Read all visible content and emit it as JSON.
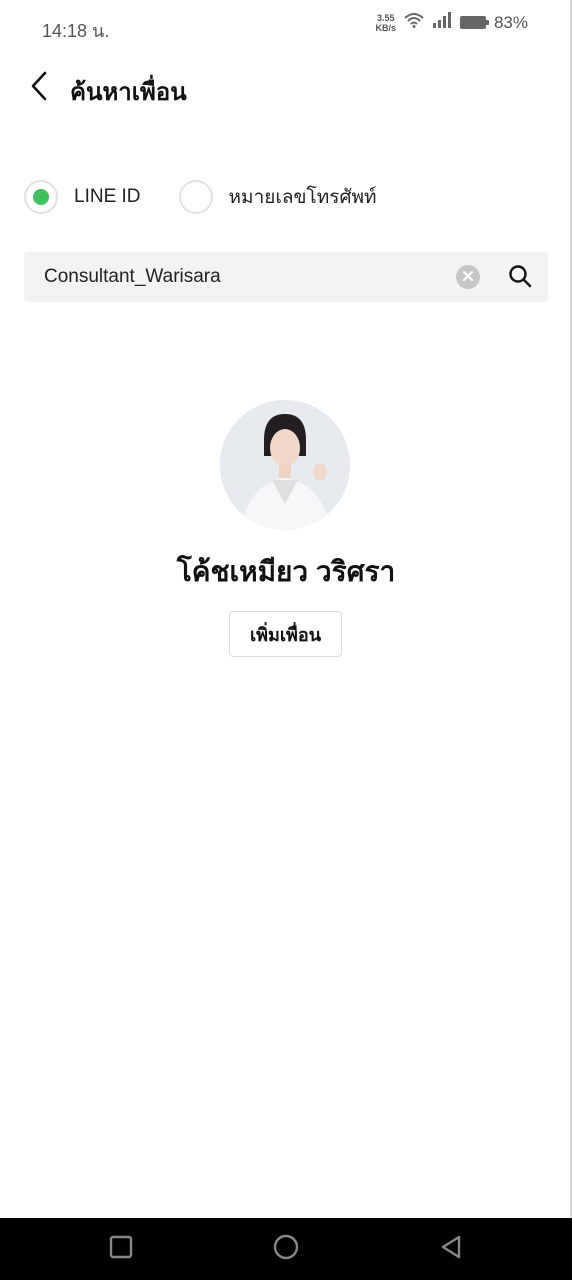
{
  "status_bar": {
    "time": "14:18 น.",
    "net_speed_value": "3.55",
    "net_speed_unit": "KB/s",
    "battery_percent": "83%",
    "icons": [
      "wifi-icon",
      "signal-icon",
      "battery-icon"
    ]
  },
  "header": {
    "title": "ค้นหาเพื่อน",
    "back_icon": "chevron-left-icon"
  },
  "search_type": {
    "options": [
      {
        "label": "LINE ID",
        "selected": true
      },
      {
        "label": "หมายเลขโทรศัพท์",
        "selected": false
      }
    ]
  },
  "search": {
    "value": "Consultant_Warisara",
    "clear_icon": "clear-icon",
    "search_icon": "search-icon"
  },
  "result": {
    "name": "โค้ชเหมียว วริศรา",
    "add_button_label": "เพิ่มเพื่อน"
  },
  "nav_bar": {
    "icons": [
      "recent-apps-icon",
      "home-icon",
      "back-icon"
    ]
  },
  "colors": {
    "accent_green": "#3fc15f",
    "search_bg": "#f3f3f3",
    "nav_bg": "#000000"
  }
}
